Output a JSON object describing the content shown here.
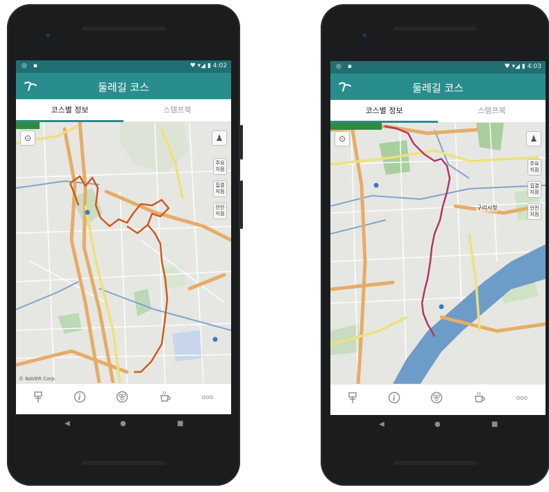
{
  "screens": [
    {
      "status": {
        "left_icons": "◎ ▪",
        "right": "♥ ▾◢ ▮ 4:02"
      },
      "app": {
        "title": "둘레길 코스"
      },
      "tabs": [
        {
          "label": "코스별 정보",
          "active": true
        },
        {
          "label": "스탬프북",
          "active": false
        }
      ],
      "map_buttons": [
        "주요\n지점",
        "집결\n지점",
        "안전\n지점"
      ],
      "map_labels": [],
      "map_credit": "© NAVER Corp.",
      "route_color": "#cc5a1e",
      "bottom_icons": [
        "trail-sign-icon",
        "info-icon",
        "stamp-icon",
        "cup-icon",
        "more-icon"
      ],
      "more_label": "ooo"
    },
    {
      "status": {
        "left_icons": "◎ ▪",
        "right": "♥ ▾◢ ▮ 4:03"
      },
      "app": {
        "title": "둘레길 코스"
      },
      "tabs": [
        {
          "label": "코스별 정보",
          "active": true
        },
        {
          "label": "스탬프북",
          "active": false
        }
      ],
      "map_buttons": [
        "주요\n지점",
        "집결\n지점",
        "안전\n지점"
      ],
      "map_labels": [
        "구리시청"
      ],
      "map_credit": "",
      "route_color": "#b2346a",
      "bottom_icons": [
        "trail-sign-icon",
        "info-icon",
        "stamp-icon",
        "cup-icon",
        "more-icon"
      ],
      "more_label": "ooo"
    }
  ],
  "colors": {
    "teal": "#2a8d8d",
    "river": "#6e9cc8",
    "road_orange": "#e8b46a",
    "road_yellow": "#efe27a",
    "park": "#bcd8b6"
  }
}
